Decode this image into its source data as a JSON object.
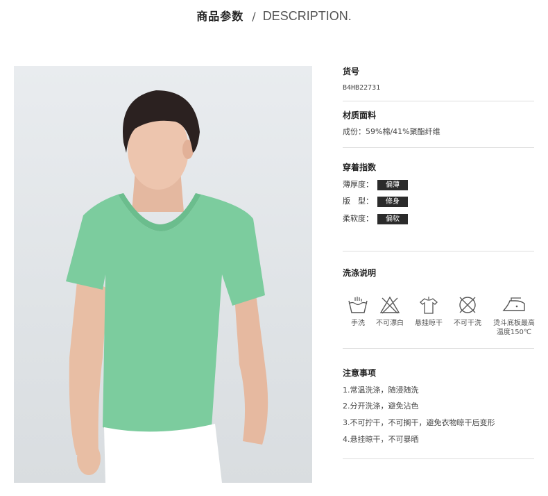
{
  "header": {
    "title_cn": "商品参数",
    "separator": "/",
    "title_en": "DESCRIPTION."
  },
  "item_no": {
    "label": "货号",
    "value": "B4HB22731"
  },
  "material": {
    "label": "材质面料",
    "value": "成份：59%棉/41%聚酯纤维"
  },
  "wear": {
    "label": "穿着指数",
    "rows": [
      {
        "name": "薄厚度：",
        "tag": "偏薄"
      },
      {
        "name": "版　型：",
        "tag": "修身"
      },
      {
        "name": "柔软度：",
        "tag": "偏软"
      }
    ]
  },
  "care": {
    "label": "洗涤说明",
    "items": [
      {
        "icon": "hand-wash-icon",
        "label": "手洗"
      },
      {
        "icon": "no-bleach-icon",
        "label": "不可漂白"
      },
      {
        "icon": "hang-dry-icon",
        "label": "悬挂晾干"
      },
      {
        "icon": "no-dry-clean-icon",
        "label": "不可干洗"
      },
      {
        "icon": "iron-icon",
        "label": "烫斗底板最高",
        "label2": "温度150℃"
      }
    ]
  },
  "notes": {
    "label": "注意事项",
    "items": [
      "1.常温洗涤，随浸随洗",
      "2.分开洗涤，避免沾色",
      "3.不可拧干，不可搁干，避免衣物晾干后变形",
      "4.悬挂晾干，不可暴晒"
    ]
  },
  "colors": {
    "shirt": "#7ccc9e",
    "tag_bg": "#2b2b2b",
    "divider": "#dddddd"
  }
}
